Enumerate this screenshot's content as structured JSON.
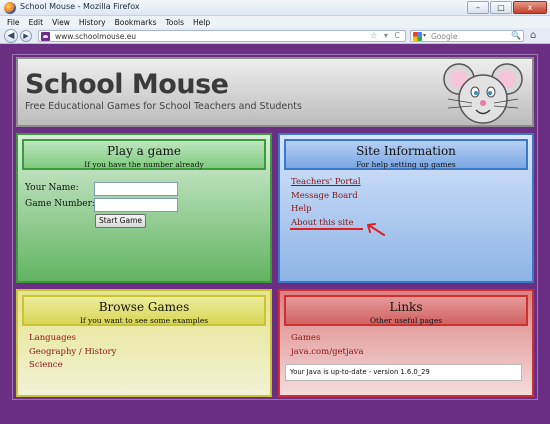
{
  "window": {
    "title": "School Mouse - Mozilla Firefox",
    "buttons": {
      "minimize": "–",
      "maximize": "□",
      "close": "x"
    }
  },
  "menubar": [
    "File",
    "Edit",
    "View",
    "History",
    "Bookmarks",
    "Tools",
    "Help"
  ],
  "navbar": {
    "back": "◀",
    "forward": "▶",
    "url": "www.schoolmouse.eu",
    "url_icons": "☆ ▾ C",
    "search_placeholder": "Google",
    "search_dropdown": "▾",
    "search_icon": "🔍",
    "home_icon": "⌂",
    "home_icon_name": "home-icon"
  },
  "header": {
    "title": "School Mouse",
    "subtitle": "Free Educational Games for School Teachers and Students"
  },
  "play_game": {
    "title": "Play a game",
    "subtitle": "If you have the number already",
    "name_label": "Your Name:",
    "number_label": "Game Number:",
    "name_value": "",
    "number_value": "",
    "start_button": "Start Game"
  },
  "site_info": {
    "title": "Site Information",
    "subtitle": "For help setting up games",
    "links": [
      "Teachers' Portal",
      "Message Board",
      "Help",
      "About this site"
    ]
  },
  "browse_games": {
    "title": "Browse Games",
    "subtitle": "If you want to see some examples",
    "links": [
      "Languages",
      "Geography / History",
      "Science"
    ]
  },
  "links_box": {
    "title": "Links",
    "subtitle": "Other useful pages",
    "links": [
      "Games",
      "java.com/getjava"
    ],
    "java_status": "Your Java is up-to-date - version 1.6.0_29"
  },
  "colors": {
    "page_background": "#6a2e82",
    "link": "#8b1414",
    "annotation": "#e02020",
    "green_box": "#3c9a3c",
    "blue_box": "#3d77c8",
    "yellow_box": "#c8c434",
    "red_box": "#cc3030"
  }
}
